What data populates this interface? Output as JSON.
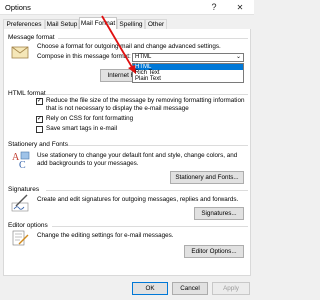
{
  "window": {
    "title": "Options",
    "help_label": "?",
    "close_label": "✕"
  },
  "tabs": [
    {
      "label": "Preferences"
    },
    {
      "label": "Mail Setup"
    },
    {
      "label": "Mail Format"
    },
    {
      "label": "Spelling"
    },
    {
      "label": "Other"
    }
  ],
  "message_format": {
    "header": "Message format",
    "line1": "Choose a format for outgoing mail and change advanced settings.",
    "compose_label": "Compose in this message format:",
    "selected": "HTML",
    "options": [
      "HTML",
      "Rich Text",
      "Plain Text"
    ],
    "internet_button": "Internet F"
  },
  "html_format": {
    "header": "HTML format",
    "reduce_line1": "Reduce the file size of the message by removing formatting information",
    "reduce_line2": "that is not necessary to display the e-mail message",
    "rely_css": "Rely on CSS for font formatting",
    "smart_tags": "Save smart tags in e-mail"
  },
  "stationery": {
    "header": "Stationery and Fonts",
    "line1": "Use stationery to change your default font and style, change colors, and",
    "line2": "add backgrounds to your messages.",
    "button": "Stationery and Fonts..."
  },
  "signatures": {
    "header": "Signatures",
    "line1": "Create and edit signatures for outgoing messages, replies and forwards.",
    "button": "Signatures..."
  },
  "editor": {
    "header": "Editor options",
    "line1": "Change the editing settings for e-mail messages.",
    "button": "Editor Options..."
  },
  "footer": {
    "ok": "OK",
    "cancel": "Cancel",
    "apply": "Apply"
  },
  "colors": {
    "accent": "#0078d7",
    "arrow": "#e01010"
  }
}
